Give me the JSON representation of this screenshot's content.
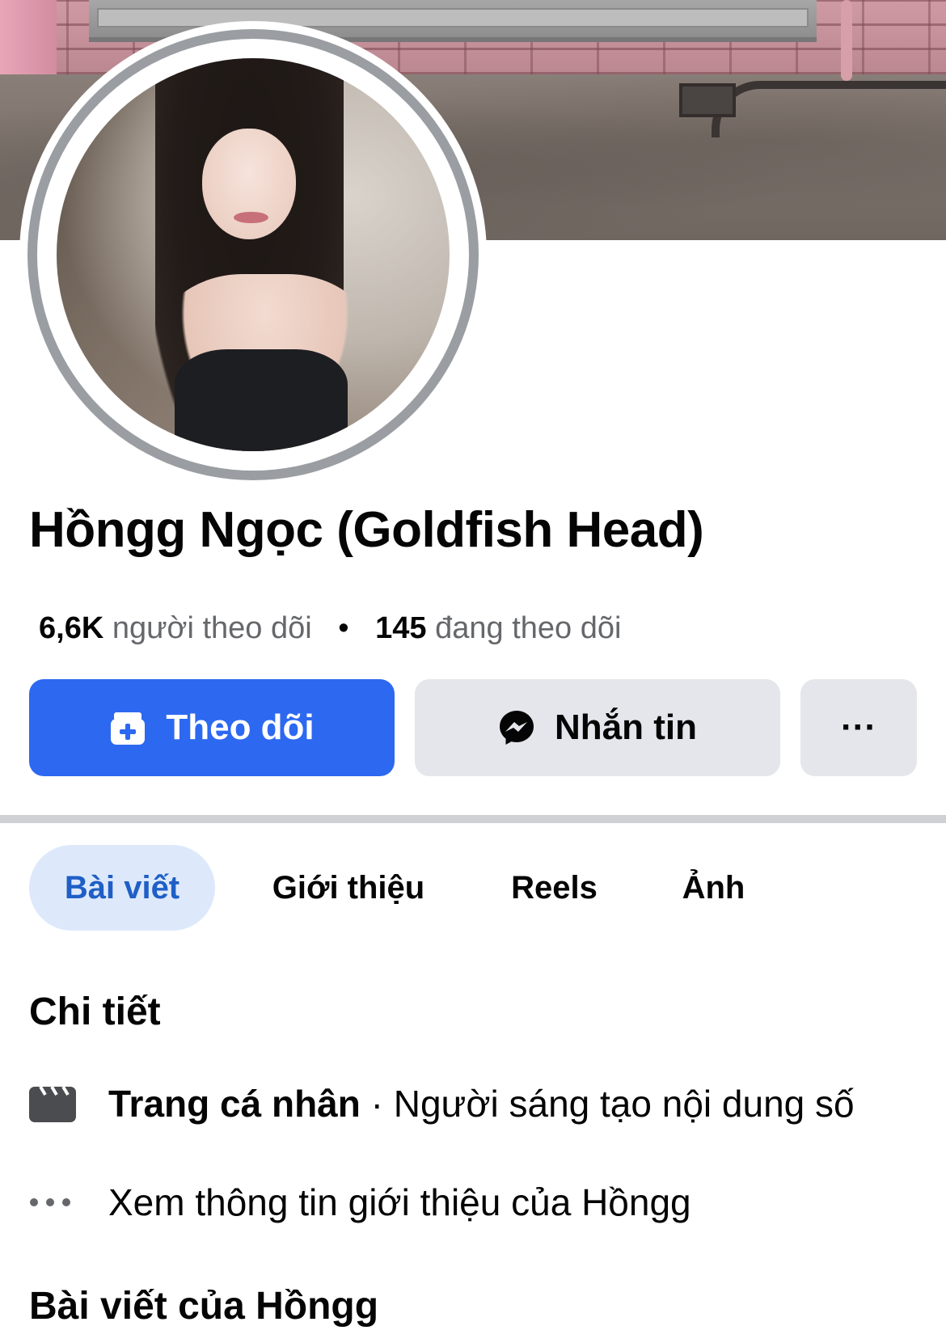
{
  "profile": {
    "name": "Hồngg Ngọc (Goldfish Head)",
    "followers_count": "6,6K",
    "followers_label": "người theo dõi",
    "separator": "•",
    "following_count": "145",
    "following_label": "đang theo dõi"
  },
  "actions": {
    "follow_label": "Theo dõi",
    "follow_icon": "follow-plus-icon",
    "message_label": "Nhắn tin",
    "message_icon": "messenger-icon",
    "more_label": "···",
    "follow_color": "#2d68f0",
    "secondary_color": "#e4e6eb"
  },
  "tabs": [
    {
      "label": "Bài viết",
      "active": true
    },
    {
      "label": "Giới thiệu",
      "active": false
    },
    {
      "label": "Reels",
      "active": false
    },
    {
      "label": "Ảnh",
      "active": false
    }
  ],
  "details": {
    "title": "Chi tiết",
    "category_strong": "Trang cá nhân",
    "category_rest": " · Người sáng tạo nội dung số",
    "category_icon": "clapperboard-icon",
    "see_about": "Xem thông tin giới thiệu của Hồngg",
    "see_about_icon": "more-dots-icon"
  },
  "posts": {
    "title": "Bài viết của Hồngg"
  }
}
